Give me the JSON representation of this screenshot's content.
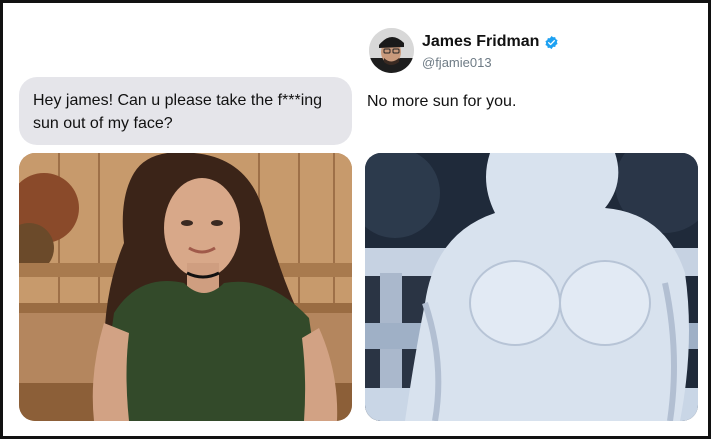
{
  "message": {
    "text": "Hey james! Can u please take the f***ing sun out of my face?"
  },
  "tweet": {
    "author_name": "James Fridman",
    "author_handle": "@fjamie013",
    "text": "No more sun for you."
  },
  "icons": {
    "verified": "verified-badge-icon",
    "avatar": "avatar"
  },
  "colors": {
    "bubble_bg": "#e5e5ea",
    "verified_blue": "#1da1f2",
    "handle_gray": "#6e7b85"
  }
}
